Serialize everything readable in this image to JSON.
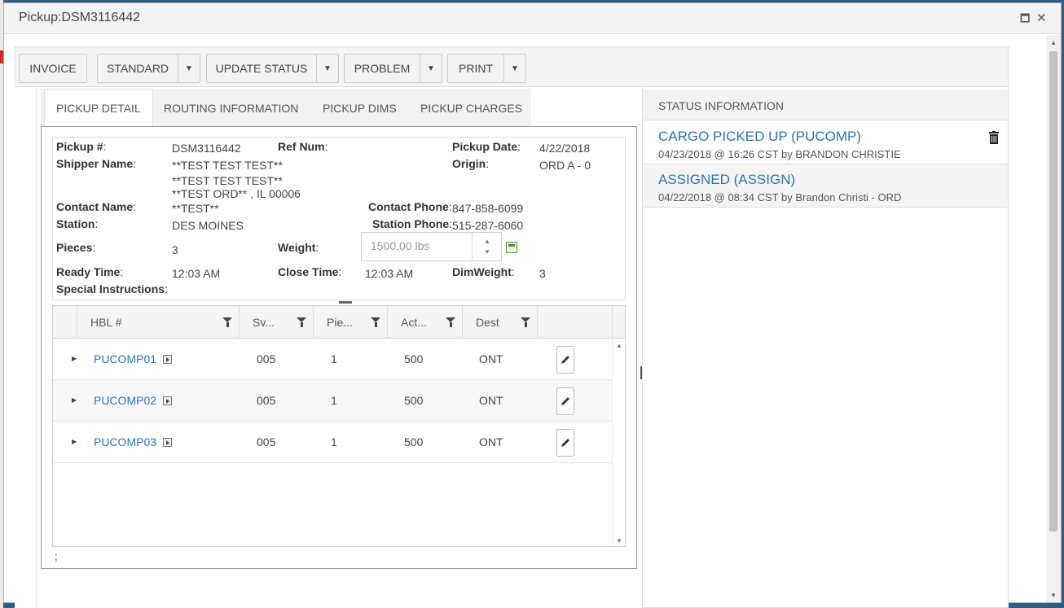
{
  "window": {
    "title": "Pickup:DSM3116442",
    "maximize_glyph": "🗖",
    "close_glyph": "✕"
  },
  "toolbar": {
    "invoice": "INVOICE",
    "standard": "STANDARD",
    "update_status": "UPDATE STATUS",
    "problem": "PROBLEM",
    "print": "PRINT",
    "caret": "▼"
  },
  "tabs": [
    "PICKUP DETAIL",
    "ROUTING INFORMATION",
    "PICKUP DIMS",
    "PICKUP CHARGES"
  ],
  "form": {
    "pickup_num_label": "Pickup #",
    "pickup_num": "DSM3116442",
    "ref_num_label": "Ref Num",
    "ref_num": "",
    "pickup_date_label": "Pickup Date",
    "pickup_date": "4/22/2018",
    "shipper_name_label": "Shipper Name",
    "shipper_line1": "**TEST TEST TEST**",
    "shipper_line2": "**TEST TEST TEST**",
    "shipper_line3": "**TEST ORD** , IL 00006",
    "origin_label": "Origin",
    "origin": "ORD A - 0",
    "contact_name_label": "Contact Name",
    "contact_name": "**TEST**",
    "contact_phone_label": "Contact Phone",
    "contact_phone": "847-858-6099",
    "station_label": "Station",
    "station": "DES MOINES",
    "station_phone_label": "Station Phone",
    "station_phone": "515-287-6060",
    "pieces_label": "Pieces",
    "pieces": "3",
    "weight_label": "Weight",
    "weight_placeholder": "1500.00 lbs",
    "ready_time_label": "Ready Time",
    "ready_time": "12:03 AM",
    "close_time_label": "Close Time",
    "close_time": "12:03 AM",
    "dimweight_label": "DimWeight",
    "dimweight": "3",
    "special_instructions_label": "Special Instructions",
    "colon": ":"
  },
  "grid": {
    "headers": [
      "HBL #",
      "Sv...",
      "Pie...",
      "Act...",
      "Dest"
    ],
    "rows": [
      {
        "hbl": "PUCOMP01",
        "svc": "005",
        "pieces": "1",
        "actual": "500",
        "dest": "ONT"
      },
      {
        "hbl": "PUCOMP02",
        "svc": "005",
        "pieces": "1",
        "actual": "500",
        "dest": "ONT"
      },
      {
        "hbl": "PUCOMP03",
        "svc": "005",
        "pieces": "1",
        "actual": "500",
        "dest": "ONT"
      }
    ]
  },
  "footer_text": ";",
  "status": {
    "header": "STATUS INFORMATION",
    "items": [
      {
        "title": "CARGO PICKED UP (PUCOMP)",
        "sub": "04/23/2018 @ 16:26 CST by BRANDON CHRISTIE"
      },
      {
        "title": "ASSIGNED (ASSIGN)",
        "sub": "04/22/2018 @ 08:34 CST by Brandon Christi - ORD"
      }
    ]
  }
}
